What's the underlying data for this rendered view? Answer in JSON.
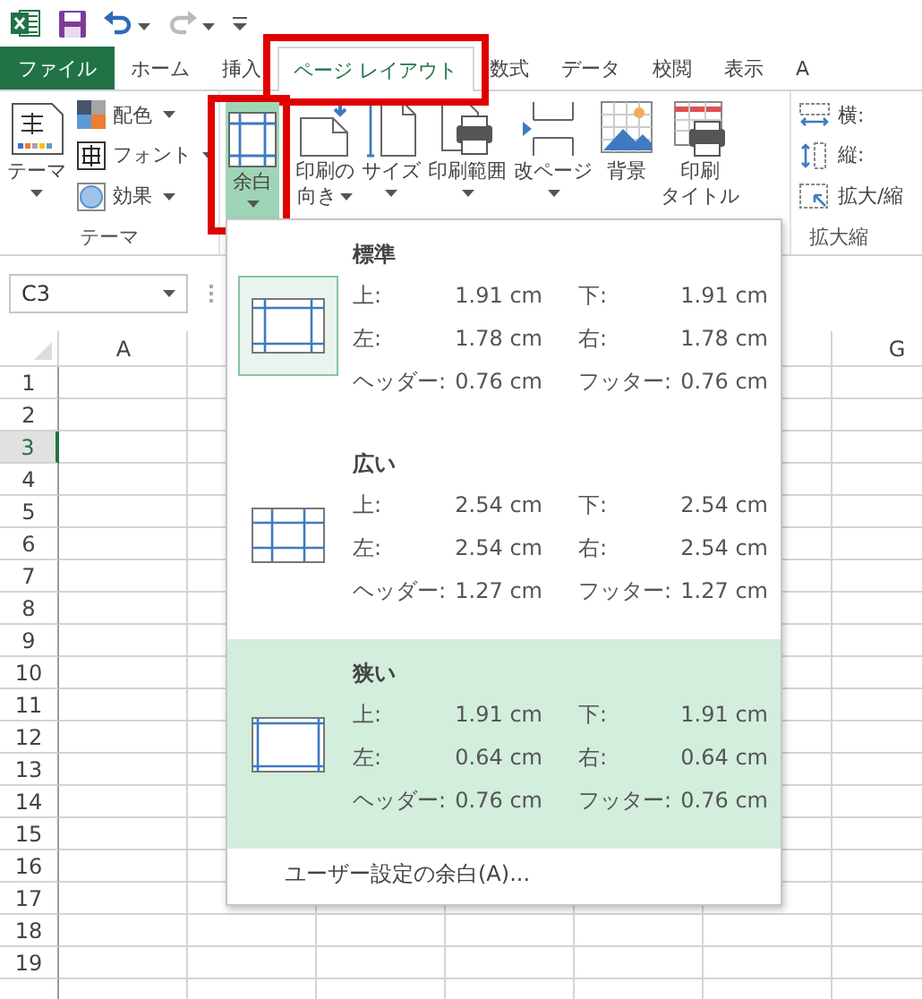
{
  "tabs": [
    {
      "label": "ファイル",
      "kind": "file",
      "selected": false,
      "callout": false
    },
    {
      "label": "ホーム",
      "kind": "tab",
      "selected": false,
      "callout": false
    },
    {
      "label": "挿入",
      "kind": "tab",
      "selected": false,
      "callout": false
    },
    {
      "label": "ページ レイアウト",
      "kind": "tab",
      "selected": true,
      "callout": true
    },
    {
      "label": "数式",
      "kind": "tab",
      "selected": false,
      "callout": false
    },
    {
      "label": "データ",
      "kind": "tab",
      "selected": false,
      "callout": false
    },
    {
      "label": "校閲",
      "kind": "tab",
      "selected": false,
      "callout": false
    },
    {
      "label": "表示",
      "kind": "tab",
      "selected": false,
      "callout": false
    },
    {
      "label": "A",
      "kind": "tab",
      "selected": false,
      "callout": false
    }
  ],
  "theme_group": {
    "label": "テーマ",
    "big_button": "テーマ",
    "items": [
      {
        "label": "配色",
        "kind": "colors"
      },
      {
        "label": "フォント",
        "kind": "fonts"
      },
      {
        "label": "効果",
        "kind": "effects"
      }
    ]
  },
  "page_setup_group": {
    "buttons": [
      {
        "lines": [
          "余白"
        ],
        "kind": "margins",
        "active": true,
        "callout": true,
        "dropdown": true
      },
      {
        "lines": [
          "印刷の",
          "向き"
        ],
        "kind": "orientation",
        "active": false,
        "callout": false,
        "dropdown": true
      },
      {
        "lines": [
          "サイズ"
        ],
        "kind": "size",
        "active": false,
        "callout": false,
        "dropdown": true
      },
      {
        "lines": [
          "印刷範囲"
        ],
        "kind": "print_area",
        "active": false,
        "callout": false,
        "dropdown": true
      },
      {
        "lines": [
          "改ページ"
        ],
        "kind": "breaks",
        "active": false,
        "callout": false,
        "dropdown": true
      },
      {
        "lines": [
          "背景"
        ],
        "kind": "background",
        "active": false,
        "callout": false,
        "dropdown": false
      },
      {
        "lines": [
          "印刷",
          "タイトル"
        ],
        "kind": "print_titles",
        "active": false,
        "callout": false,
        "dropdown": false
      }
    ]
  },
  "scale_group": {
    "label": "拡大縮",
    "items": [
      {
        "label": "横:",
        "kind": "width"
      },
      {
        "label": "縦:",
        "kind": "height"
      },
      {
        "label": "拡大/縮",
        "kind": "scale"
      }
    ]
  },
  "name_box": "C3",
  "columns": [
    "A",
    "G"
  ],
  "rows": [
    {
      "label": "1",
      "selected": false
    },
    {
      "label": "2",
      "selected": false
    },
    {
      "label": "3",
      "selected": true
    },
    {
      "label": "4",
      "selected": false
    },
    {
      "label": "5",
      "selected": false
    },
    {
      "label": "6",
      "selected": false
    },
    {
      "label": "7",
      "selected": false
    },
    {
      "label": "8",
      "selected": false
    },
    {
      "label": "9",
      "selected": false
    },
    {
      "label": "10",
      "selected": false
    },
    {
      "label": "11",
      "selected": false
    },
    {
      "label": "12",
      "selected": false
    },
    {
      "label": "13",
      "selected": false
    },
    {
      "label": "14",
      "selected": false
    },
    {
      "label": "15",
      "selected": false
    },
    {
      "label": "16",
      "selected": false
    },
    {
      "label": "17",
      "selected": false
    },
    {
      "label": "18",
      "selected": false
    },
    {
      "label": "19",
      "selected": false
    }
  ],
  "margin_menu": {
    "options": [
      {
        "name": "標準",
        "kind": "normal",
        "selected": true,
        "hovered": false,
        "values": [
          {
            "label": "上:",
            "value": "1.91 cm"
          },
          {
            "label": "下:",
            "value": "1.91 cm"
          },
          {
            "label": "左:",
            "value": "1.78 cm"
          },
          {
            "label": "右:",
            "value": "1.78 cm"
          },
          {
            "label": "ヘッダー:",
            "value": "0.76 cm"
          },
          {
            "label": "フッター:",
            "value": "0.76 cm"
          }
        ]
      },
      {
        "name": "広い",
        "kind": "wide",
        "selected": false,
        "hovered": false,
        "values": [
          {
            "label": "上:",
            "value": "2.54 cm"
          },
          {
            "label": "下:",
            "value": "2.54 cm"
          },
          {
            "label": "左:",
            "value": "2.54 cm"
          },
          {
            "label": "右:",
            "value": "2.54 cm"
          },
          {
            "label": "ヘッダー:",
            "value": "1.27 cm"
          },
          {
            "label": "フッター:",
            "value": "1.27 cm"
          }
        ]
      },
      {
        "name": "狭い",
        "kind": "narrow",
        "selected": false,
        "hovered": true,
        "values": [
          {
            "label": "上:",
            "value": "1.91 cm"
          },
          {
            "label": "下:",
            "value": "1.91 cm"
          },
          {
            "label": "左:",
            "value": "0.64 cm"
          },
          {
            "label": "右:",
            "value": "0.64 cm"
          },
          {
            "label": "ヘッダー:",
            "value": "0.76 cm"
          },
          {
            "label": "フッター:",
            "value": "0.76 cm"
          }
        ]
      }
    ],
    "custom": "ユーザー設定の余白(A)..."
  }
}
